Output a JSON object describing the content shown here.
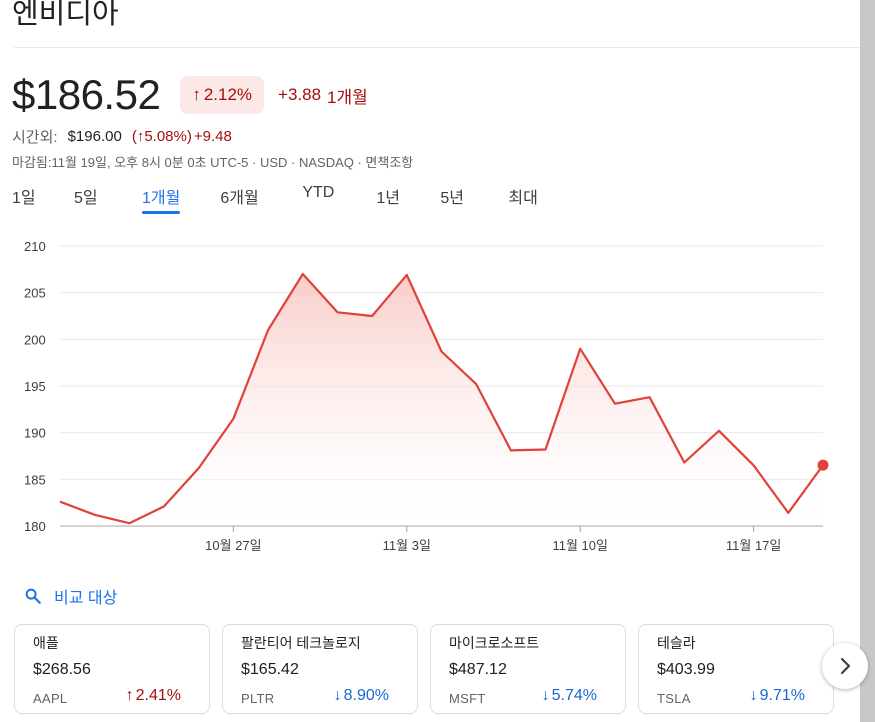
{
  "page": {
    "title": "엔비디아"
  },
  "quote": {
    "price": "$186.52",
    "change_pct": "2.12%",
    "change_abs": "+3.88",
    "period": "1개월",
    "after_hours": {
      "label": "시간외:",
      "price": "$196.00",
      "pct": "5.08%",
      "abs": "+9.48"
    },
    "meta": "마감됨:11월 19일, 오후 8시 0분 0초 UTC-5 · USD · NASDAQ · 면책조항"
  },
  "tabs": [
    {
      "label": "1일",
      "active": false
    },
    {
      "label": "5일",
      "active": false
    },
    {
      "label": "1개월",
      "active": true
    },
    {
      "label": "6개월",
      "active": false
    },
    {
      "label": "YTD",
      "active": false
    },
    {
      "label": "1년",
      "active": false
    },
    {
      "label": "5년",
      "active": false
    },
    {
      "label": "최대",
      "active": false
    }
  ],
  "chart_data": {
    "type": "area",
    "ylim": [
      180,
      210
    ],
    "yticks": [
      210,
      205,
      200,
      195,
      190,
      185,
      180
    ],
    "xtick_labels": [
      "10월 27일",
      "11월 3일",
      "11월 10일",
      "11월 17일"
    ],
    "xtick_indices": [
      5,
      10,
      15,
      20
    ],
    "series": [
      {
        "values": [
          182.6,
          181.2,
          180.3,
          182.1,
          186.2,
          191.5,
          201.0,
          207.0,
          202.9,
          202.5,
          206.9,
          198.7,
          195.2,
          188.1,
          188.2,
          199.0,
          193.1,
          193.8,
          186.8,
          190.2,
          186.5,
          181.4,
          186.52
        ]
      }
    ],
    "grid": true,
    "colors": {
      "line": "#e0413a",
      "fill": "#f8c9c5",
      "grid": "#e8eaed",
      "axis": "#9aa0a6"
    }
  },
  "compare": {
    "label": "비교 대상"
  },
  "cards": [
    {
      "name": "애플",
      "price": "$268.56",
      "ticker": "AAPL",
      "change": "2.41%",
      "direction": "up"
    },
    {
      "name": "팔란티어 테크놀로지",
      "price": "$165.42",
      "ticker": "PLTR",
      "change": "8.90%",
      "direction": "down"
    },
    {
      "name": "마이크로소프트",
      "price": "$487.12",
      "ticker": "MSFT",
      "change": "5.74%",
      "direction": "down"
    },
    {
      "name": "테슬라",
      "price": "$403.99",
      "ticker": "TSLA",
      "change": "9.71%",
      "direction": "down"
    }
  ],
  "colors": {
    "up": "#a50e0e",
    "down": "#1967d2",
    "accent": "#1a73e8",
    "badge_bg": "#fce8e6"
  }
}
